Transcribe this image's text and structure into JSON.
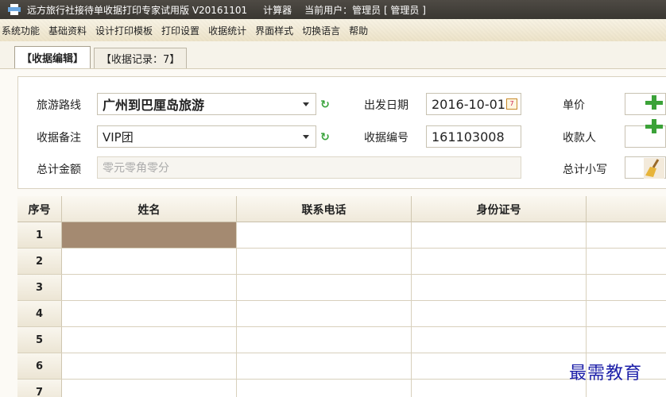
{
  "window": {
    "title": "远方旅行社接待单收据打印专家试用版 V20161101",
    "calculator": "计算器",
    "current_user": "当前用户：管理员 [ 管理员 ]"
  },
  "menu": [
    "系统功能",
    "基础资料",
    "设计打印模板",
    "打印设置",
    "收据统计",
    "界面样式",
    "切换语言",
    "帮助"
  ],
  "tabs": [
    {
      "label": "【收据编辑】",
      "active": true
    },
    {
      "label": "【收据记录：7】",
      "active": false
    }
  ],
  "form": {
    "route_label": "旅游路线",
    "route_value": "广州到巴厘岛旅游",
    "remark_label": "收据备注",
    "remark_value": "VIP团",
    "total_label": "总计金额",
    "total_placeholder": "零元零角零分",
    "date_label": "出发日期",
    "date_value": "2016-10-01",
    "number_label": "收据编号",
    "number_value": "161103008",
    "price_label": "单价",
    "payee_label": "收款人",
    "subtotal_label": "总计小写"
  },
  "grid": {
    "columns": [
      "序号",
      "姓名",
      "联系电话",
      "身份证号"
    ],
    "rows": [
      "1",
      "2",
      "3",
      "4",
      "5",
      "6",
      "7"
    ],
    "selected_row": 1
  },
  "watermark": "最需教育",
  "colors": {
    "accent_green": "#3ba238",
    "selected_cell": "#a48a71",
    "watermark": "#1c1fa8"
  }
}
